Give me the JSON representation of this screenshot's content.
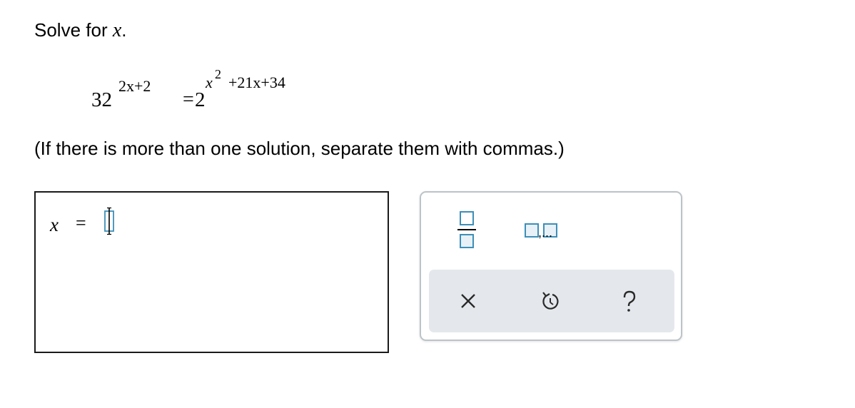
{
  "question": {
    "prefix": "Solve for",
    "variable": "x",
    "suffix": "."
  },
  "equation": {
    "left_base": "32",
    "left_exponent": "2x+2",
    "equals": "=",
    "right_base": "2",
    "right_exp_var": "x",
    "right_exp_power": "2",
    "right_exp_rest": "+21x+34"
  },
  "instruction": "(If there is more than one solution, separate them with commas.)",
  "answer": {
    "variable": "x",
    "equals": "=",
    "value": ""
  },
  "palette": {
    "tools": [
      {
        "name": "fraction",
        "icon": "fraction-icon"
      },
      {
        "name": "list",
        "icon": "comma-list-icon"
      }
    ],
    "actions": [
      {
        "name": "clear",
        "icon": "close-icon"
      },
      {
        "name": "undo",
        "icon": "undo-icon"
      },
      {
        "name": "help",
        "icon": "help-icon"
      }
    ],
    "list_suffix": ",..."
  },
  "colors": {
    "template_box": "#3d8fb8",
    "template_fill": "#e7f1f7",
    "action_bar": "#e4e8ec",
    "palette_border": "#bcc3c9"
  }
}
